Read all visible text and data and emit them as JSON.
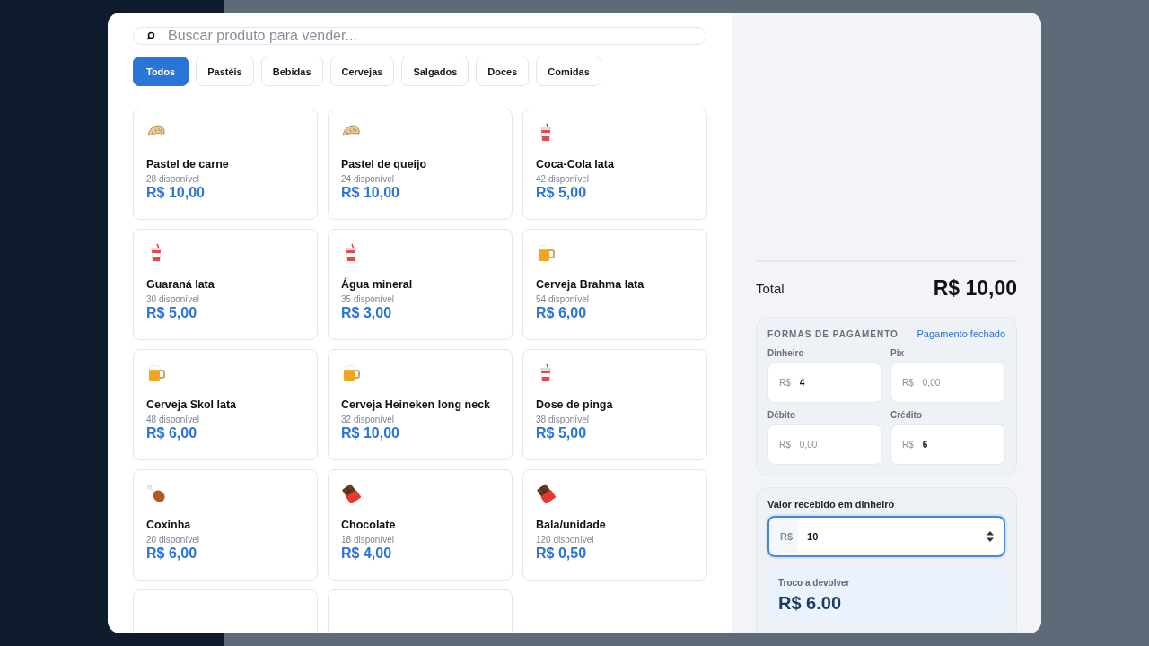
{
  "search": {
    "placeholder": "Buscar produto para vender..."
  },
  "categories": [
    {
      "label": "Todos",
      "selected": true
    },
    {
      "label": "Pastéis",
      "selected": false
    },
    {
      "label": "Bebidas",
      "selected": false
    },
    {
      "label": "Cervejas",
      "selected": false
    },
    {
      "label": "Salgados",
      "selected": false
    },
    {
      "label": "Doces",
      "selected": false
    },
    {
      "label": "Comidas",
      "selected": false
    }
  ],
  "products": [
    {
      "kind": "pastry",
      "name": "Pastel de carne",
      "stock": "28 disponível",
      "price": "R$ 10,00"
    },
    {
      "kind": "pastry",
      "name": "Pastel de queijo",
      "stock": "24 disponível",
      "price": "R$ 10,00"
    },
    {
      "kind": "drink",
      "name": "Coca-Cola lata",
      "stock": "42 disponível",
      "price": "R$ 5,00"
    },
    {
      "kind": "drink",
      "name": "Guaraná lata",
      "stock": "30 disponível",
      "price": "R$ 5,00"
    },
    {
      "kind": "drink",
      "name": "Água mineral",
      "stock": "35 disponível",
      "price": "R$ 3,00"
    },
    {
      "kind": "beer",
      "name": "Cerveja Brahma lata",
      "stock": "54 disponível",
      "price": "R$ 6,00"
    },
    {
      "kind": "beer",
      "name": "Cerveja Skol lata",
      "stock": "48 disponível",
      "price": "R$ 6,00"
    },
    {
      "kind": "beer",
      "name": "Cerveja Heineken long neck",
      "stock": "32 disponível",
      "price": "R$ 10,00"
    },
    {
      "kind": "drink",
      "name": "Dose de pinga",
      "stock": "38 disponível",
      "price": "R$ 5,00"
    },
    {
      "kind": "chicken",
      "name": "Coxinha",
      "stock": "20 disponível",
      "price": "R$ 6,00"
    },
    {
      "kind": "chocolate",
      "name": "Chocolate",
      "stock": "18 disponível",
      "price": "R$ 4,00"
    },
    {
      "kind": "chocolate",
      "name": "Bala/unidade",
      "stock": "120 disponível",
      "price": "R$ 0,50"
    },
    {
      "kind": "cut"
    },
    {
      "kind": "cut"
    }
  ],
  "cart": {
    "total_label": "Total",
    "total": "R$ 10,00"
  },
  "payment": {
    "title": "FORMAS DE PAGAMENTO",
    "status": "Pagamento fechado",
    "methods": [
      {
        "label": "Dinheiro",
        "currency": "R$",
        "value": "4"
      },
      {
        "label": "Pix",
        "currency": "R$",
        "placeholder": "0,00"
      },
      {
        "label": "Débito",
        "currency": "R$",
        "placeholder": "0,00"
      },
      {
        "label": "Crédito",
        "currency": "R$",
        "value": "6"
      }
    ]
  },
  "cash": {
    "label": "Valor recebido em dinheiro",
    "currency": "R$",
    "value": "10",
    "focused": true,
    "change_label": "Troco a devolver",
    "change": "R$ 6.00"
  }
}
